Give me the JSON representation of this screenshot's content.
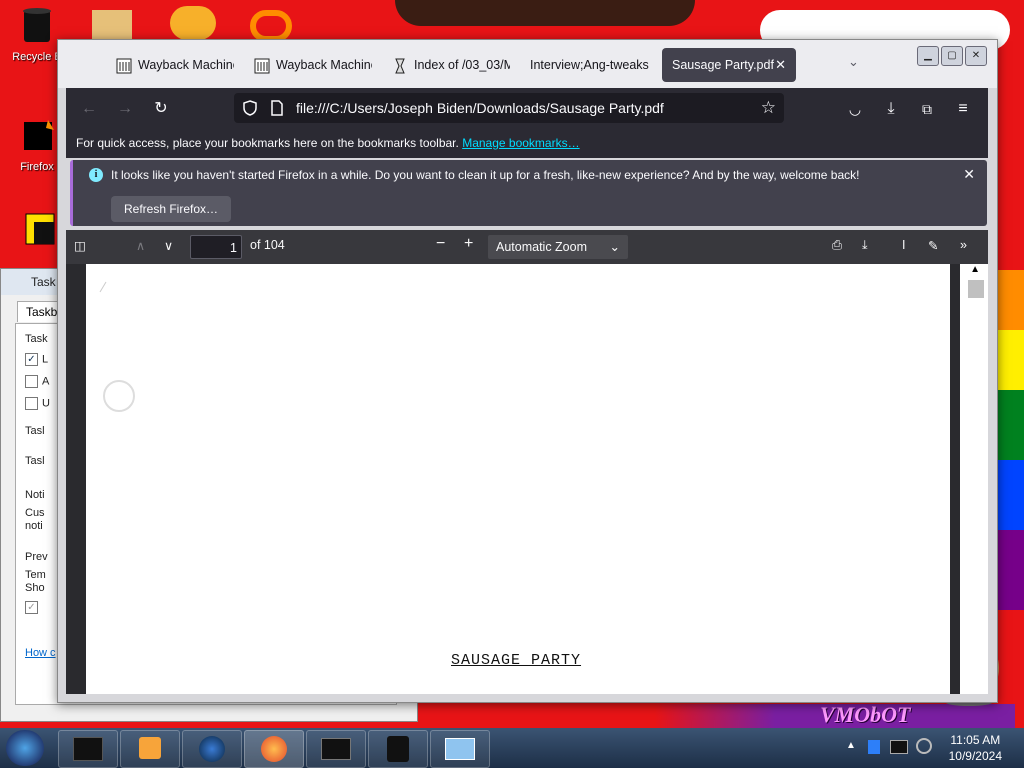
{
  "desktop": {
    "icons": [
      {
        "label": "Recycle B"
      },
      {
        "label": "Firefox"
      }
    ],
    "watermark": "VMObOT"
  },
  "behind_window": {
    "title": "Task",
    "tab": "Taskba",
    "rows": [
      "Task",
      "L",
      "A",
      "U",
      "Tasl",
      "Tasl",
      "Noti",
      "Cus",
      "noti",
      "Prev",
      "Tem",
      "Sho",
      "How c"
    ]
  },
  "browser": {
    "tabs": [
      {
        "label": "Wayback Machine",
        "icon": "archive-icon"
      },
      {
        "label": "Wayback Machine",
        "icon": "archive-icon"
      },
      {
        "label": "Index of /03_03/M",
        "icon": "hourglass-icon"
      },
      {
        "label": "Interview;Ang-tweaks",
        "icon": ""
      },
      {
        "label": "Sausage Party.pdf",
        "icon": "",
        "active": true
      }
    ],
    "url": "file:///C:/Users/Joseph Biden/Downloads/Sausage Party.pdf",
    "bookmarks_bar": {
      "text": "For quick access, place your bookmarks here on the bookmarks toolbar.",
      "link": "Manage bookmarks…"
    },
    "notification": {
      "text": "It looks like you haven't started Firefox in a while. Do you want to clean it up for a fresh, like-new experience? And by the way, welcome back!",
      "button": "Refresh Firefox…"
    },
    "pdf": {
      "page_current": "1",
      "page_total": "of 104",
      "zoom": "Automatic Zoom",
      "page_text": "SAUSAGE PARTY"
    }
  },
  "taskbar": {
    "time": "11:05 AM",
    "date": "10/9/2024"
  },
  "colors": {
    "accent_active_tab": "#42414d",
    "toolbar": "#2b2a33",
    "link": "#00ddff",
    "desktop_red": "#e81416"
  }
}
